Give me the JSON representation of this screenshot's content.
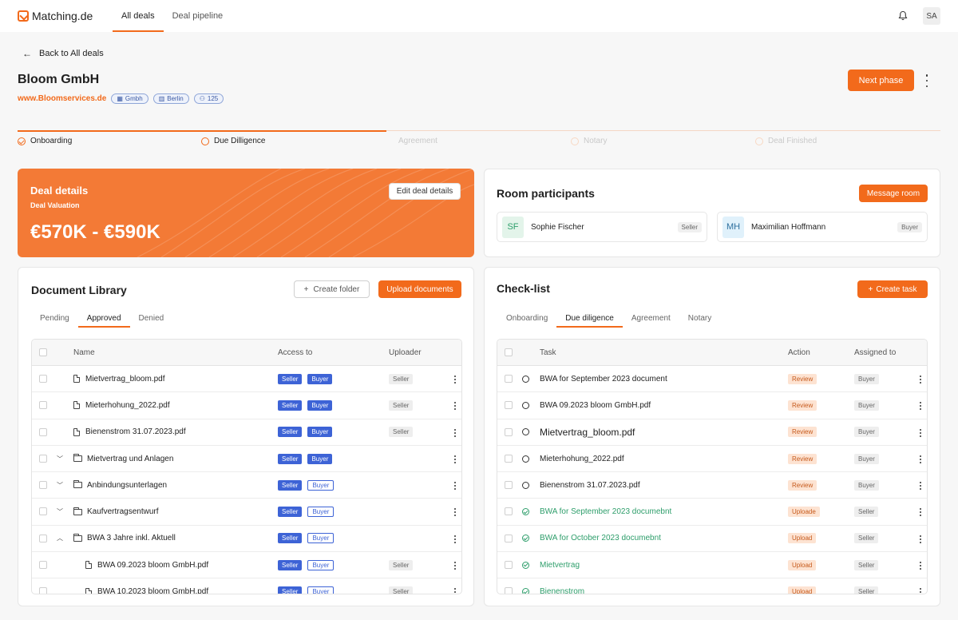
{
  "nav": {
    "brand": "Matching.de",
    "tabs": [
      {
        "label": "All deals"
      },
      {
        "label": "Deal pipeline"
      }
    ],
    "user_initials": "SA"
  },
  "header": {
    "back_label": "Back to All deals",
    "company": "Bloom GmbH",
    "website": "www.Bloomservices.de",
    "chips": [
      {
        "icon": "building-icon",
        "label": "Gmbh"
      },
      {
        "icon": "map-icon",
        "label": "Berlin"
      },
      {
        "icon": "people-icon",
        "label": "125"
      }
    ],
    "next_phase_label": "Next phase"
  },
  "stepper": {
    "steps": [
      {
        "label": "Onboarding",
        "state": "done"
      },
      {
        "label": "Due Dilligence",
        "state": "current"
      },
      {
        "label": "Agreement",
        "state": "future"
      },
      {
        "label": "Notary",
        "state": "future"
      },
      {
        "label": "Deal Finished",
        "state": "future"
      }
    ]
  },
  "deal": {
    "title": "Deal details",
    "subtitle": "Deal Valuation",
    "value": "€570K - €590K",
    "edit_label": "Edit deal details",
    "color": "#f37a36"
  },
  "room": {
    "title": "Room participants",
    "message_label": "Message room",
    "participants": [
      {
        "initials": "SF",
        "name": "Sophie Fischer",
        "role": "Seller"
      },
      {
        "initials": "MH",
        "name": "Maximilian Hoffmann",
        "role": "Buyer"
      }
    ]
  },
  "library": {
    "title": "Document Library",
    "create_folder_label": "Create folder",
    "upload_label": "Upload documents",
    "tabs": [
      "Pending",
      "Approved",
      "Denied"
    ],
    "active_tab": "Approved",
    "columns": [
      "Name",
      "Access to",
      "Uploader"
    ],
    "rows": [
      {
        "type": "file",
        "indent": 0,
        "name": "Mietvertrag_bloom.pdf",
        "access": [
          "Seller",
          "Buyer"
        ],
        "buyer_style": "fill",
        "uploader": "Seller"
      },
      {
        "type": "file",
        "indent": 0,
        "name": "Mieterhohung_2022.pdf",
        "access": [
          "Seller",
          "Buyer"
        ],
        "buyer_style": "fill",
        "uploader": "Seller"
      },
      {
        "type": "file",
        "indent": 0,
        "name": "Bienenstrom 31.07.2023.pdf",
        "access": [
          "Seller",
          "Buyer"
        ],
        "buyer_style": "fill",
        "uploader": "Seller"
      },
      {
        "type": "folder",
        "indent": 0,
        "chevron": "down",
        "name": "Mietvertrag und Anlagen",
        "access": [
          "Seller",
          "Buyer"
        ],
        "buyer_style": "fill",
        "uploader": ""
      },
      {
        "type": "folder",
        "indent": 0,
        "chevron": "down",
        "name": "Anbindungsunterlagen",
        "access": [
          "Seller",
          "Buyer"
        ],
        "buyer_style": "outline",
        "uploader": ""
      },
      {
        "type": "folder",
        "indent": 0,
        "chevron": "down",
        "name": "Kaufvertragsentwurf",
        "access": [
          "Seller",
          "Buyer"
        ],
        "buyer_style": "outline",
        "uploader": ""
      },
      {
        "type": "folder",
        "indent": 0,
        "chevron": "up",
        "name": "BWA 3 Jahre inkl. Aktuell",
        "access": [
          "Seller",
          "Buyer"
        ],
        "buyer_style": "outline",
        "uploader": ""
      },
      {
        "type": "file",
        "indent": 1,
        "name": "BWA 09.2023 bloom GmbH.pdf",
        "access": [
          "Seller",
          "Buyer"
        ],
        "buyer_style": "outline",
        "uploader": "Seller"
      },
      {
        "type": "file",
        "indent": 1,
        "name": "BWA 10.2023 bloom GmbH.pdf",
        "access": [
          "Seller",
          "Buyer"
        ],
        "buyer_style": "outline",
        "uploader": "Seller"
      }
    ]
  },
  "checklist": {
    "title": "Check-list",
    "create_label": "Create task",
    "tabs": [
      "Onboarding",
      "Due diligence",
      "Agreement",
      "Notary"
    ],
    "active_tab": "Due diligence",
    "columns": [
      "Task",
      "Action",
      "Assigned to"
    ],
    "rows": [
      {
        "done": false,
        "task": "BWA for September 2023 document",
        "action": "Review",
        "assigned": "Buyer"
      },
      {
        "done": false,
        "task": "BWA 09.2023 bloom GmbH.pdf",
        "action": "Review",
        "assigned": "Buyer"
      },
      {
        "done": false,
        "task": "Mietvertrag_bloom.pdf",
        "action": "Review",
        "assigned": "Buyer"
      },
      {
        "done": false,
        "task": "Mieterhohung_2022.pdf",
        "action": "Review",
        "assigned": "Buyer"
      },
      {
        "done": false,
        "task": "Bienenstrom 31.07.2023.pdf",
        "action": "Review",
        "assigned": "Buyer"
      },
      {
        "done": true,
        "task": "BWA for September 2023 documebnt",
        "action": "Uploade",
        "assigned": "Seller"
      },
      {
        "done": true,
        "task": "BWA for October 2023 documebnt",
        "action": "Upload",
        "assigned": "Seller"
      },
      {
        "done": true,
        "task": "Mietvertrag",
        "action": "Upload",
        "assigned": "Seller"
      },
      {
        "done": true,
        "task": "Bienenstrom",
        "action": "Upload",
        "assigned": "Seller"
      }
    ]
  },
  "colors": {
    "accent": "#f26a1b",
    "blue": "#3d63d6",
    "green": "#2e9e6b"
  }
}
